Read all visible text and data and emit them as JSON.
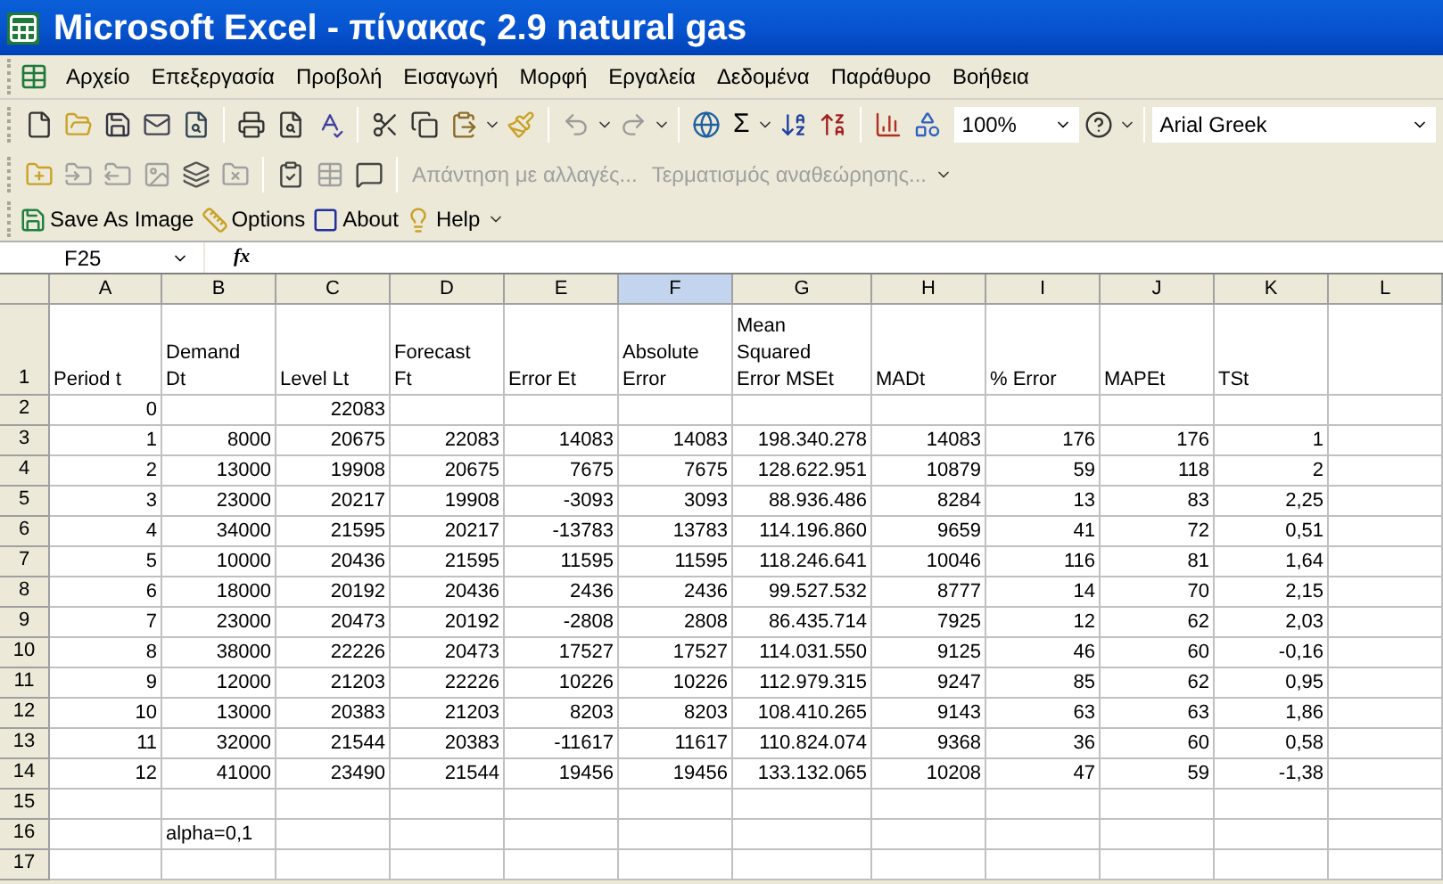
{
  "window": {
    "title": "Microsoft Excel - πίνακας 2.9 natural gas"
  },
  "menu": [
    "Αρχείο",
    "Επεξεργασία",
    "Προβολή",
    "Εισαγωγή",
    "Μορφή",
    "Εργαλεία",
    "Δεδομένα",
    "Παράθυρο",
    "Βοήθεια"
  ],
  "standard_toolbar": {
    "sum": "Σ",
    "zoom": "100%",
    "font": "Arial Greek"
  },
  "reviewing_toolbar": [
    {
      "label": "Απάντηση με αλλαγές...",
      "disabled": true
    },
    {
      "label": "Τερματισμός αναθεώρησης...",
      "disabled": true
    }
  ],
  "addin_toolbar": [
    "Save As Image",
    "Options",
    "About",
    "Help"
  ],
  "formula_bar": {
    "name_box": "F25",
    "fx": "fx"
  },
  "sheet": {
    "columns": [
      {
        "label": "A",
        "selected": false
      },
      {
        "label": "B",
        "selected": false
      },
      {
        "label": "C",
        "selected": false
      },
      {
        "label": "D",
        "selected": false
      },
      {
        "label": "E",
        "selected": false
      },
      {
        "label": "F",
        "selected": true
      },
      {
        "label": "G",
        "selected": false
      },
      {
        "label": "H",
        "selected": false
      },
      {
        "label": "I",
        "selected": false
      },
      {
        "label": "J",
        "selected": false
      },
      {
        "label": "K",
        "selected": false
      },
      {
        "label": "L",
        "selected": false
      }
    ],
    "rows": [
      {
        "header": "1",
        "kind": "heading",
        "cells": [
          "Period t",
          "Demand\nDt",
          "Level Lt",
          "Forecast\nFt",
          "Error Et",
          "Absolute\nError",
          "Mean\nSquared\nError MSEt",
          "MADt",
          "% Error",
          "MAPEt",
          "TSt"
        ]
      },
      {
        "header": "2",
        "kind": "number",
        "cells": [
          "0",
          null,
          "22083"
        ]
      },
      {
        "header": "3",
        "kind": "number",
        "cells": [
          "1",
          "8000",
          "20675",
          "22083",
          "14083",
          "14083",
          "198.340.278",
          "14083",
          "176",
          "176",
          "1"
        ]
      },
      {
        "header": "4",
        "kind": "number",
        "cells": [
          "2",
          "13000",
          "19908",
          "20675",
          "7675",
          "7675",
          "128.622.951",
          "10879",
          "59",
          "118",
          "2"
        ]
      },
      {
        "header": "5",
        "kind": "number",
        "cells": [
          "3",
          "23000",
          "20217",
          "19908",
          "-3093",
          "3093",
          "88.936.486",
          "8284",
          "13",
          "83",
          "2,25"
        ]
      },
      {
        "header": "6",
        "kind": "number",
        "cells": [
          "4",
          "34000",
          "21595",
          "20217",
          "-13783",
          "13783",
          "114.196.860",
          "9659",
          "41",
          "72",
          "0,51"
        ]
      },
      {
        "header": "7",
        "kind": "number",
        "cells": [
          "5",
          "10000",
          "20436",
          "21595",
          "11595",
          "11595",
          "118.246.641",
          "10046",
          "116",
          "81",
          "1,64"
        ]
      },
      {
        "header": "8",
        "kind": "number",
        "cells": [
          "6",
          "18000",
          "20192",
          "20436",
          "2436",
          "2436",
          "99.527.532",
          "8777",
          "14",
          "70",
          "2,15"
        ]
      },
      {
        "header": "9",
        "kind": "number",
        "cells": [
          "7",
          "23000",
          "20473",
          "20192",
          "-2808",
          "2808",
          "86.435.714",
          "7925",
          "12",
          "62",
          "2,03"
        ]
      },
      {
        "header": "10",
        "kind": "number",
        "cells": [
          "8",
          "38000",
          "22226",
          "20473",
          "17527",
          "17527",
          "114.031.550",
          "9125",
          "46",
          "60",
          "-0,16"
        ]
      },
      {
        "header": "11",
        "kind": "number",
        "cells": [
          "9",
          "12000",
          "21203",
          "22226",
          "10226",
          "10226",
          "112.979.315",
          "9247",
          "85",
          "62",
          "0,95"
        ]
      },
      {
        "header": "12",
        "kind": "number",
        "cells": [
          "10",
          "13000",
          "20383",
          "21203",
          "8203",
          "8203",
          "108.410.265",
          "9143",
          "63",
          "63",
          "1,86"
        ]
      },
      {
        "header": "13",
        "kind": "number",
        "cells": [
          "11",
          "32000",
          "21544",
          "20383",
          "-11617",
          "11617",
          "110.824.074",
          "9368",
          "36",
          "60",
          "0,58"
        ]
      },
      {
        "header": "14",
        "kind": "number",
        "cells": [
          "12",
          "41000",
          "23490",
          "21544",
          "19456",
          "19456",
          "133.132.065",
          "10208",
          "47",
          "59",
          "-1,38"
        ]
      },
      {
        "header": "15"
      },
      {
        "header": "16",
        "kind": "text",
        "cells": [
          null,
          "alpha=0,1"
        ]
      },
      {
        "header": "17"
      }
    ]
  }
}
